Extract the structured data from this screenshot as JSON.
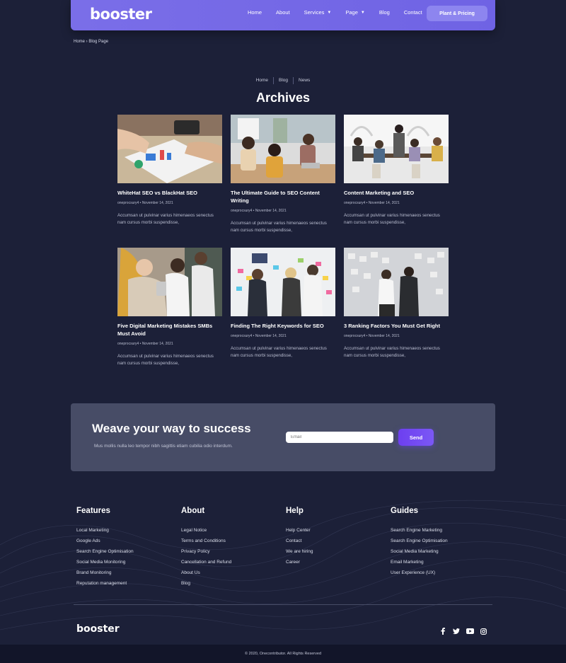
{
  "header": {
    "logo": "booster",
    "nav": [
      {
        "label": "Home"
      },
      {
        "label": "About"
      },
      {
        "label": "Services",
        "dropdown": true
      },
      {
        "label": "Page",
        "dropdown": true
      },
      {
        "label": "Blog"
      },
      {
        "label": "Contact"
      }
    ],
    "cta": "Plant & Pricing"
  },
  "breadcrumb_top": "Home › Blog Page",
  "breadcrumbs": [
    "Home",
    "Blog",
    "News"
  ],
  "page_title": "Archives",
  "posts": [
    {
      "title": "WhiteHat SEO vs BlackHat SEO",
      "meta": "oneprocsury4 • November 14, 2021",
      "excerpt": "Accumsan ut pulvinar varius himenaeos senectus nam cursus morbi suspendisse,"
    },
    {
      "title": "The Ultimate Guide to SEO Content Writing",
      "meta": "oneprocsury4 • November 14, 2021",
      "excerpt": "Accumsan ut pulvinar varius himenaeos senectus nam cursus morbi suspendisse,"
    },
    {
      "title": "Content Marketing and SEO",
      "meta": "oneprocsury4 • November 14, 2021",
      "excerpt": "Accumsan ut pulvinar varius himenaeos senectus nam cursus morbi suspendisse,"
    },
    {
      "title": "Five Digital Marketing Mistakes SMBs Must Avoid",
      "meta": "oneprocsury4 • November 14, 2021",
      "excerpt": "Accumsan ut pulvinar varius himenaeos senectus nam cursus morbi suspendisse,"
    },
    {
      "title": "Finding The Right Keywords for SEO",
      "meta": "oneprocsury4 • November 14, 2021",
      "excerpt": "Accumsan ut pulvinar varius himenaeos senectus nam cursus morbi suspendisse,"
    },
    {
      "title": "3 Ranking Factors You Must Get Right",
      "meta": "oneprocsury4 • November 14, 2021",
      "excerpt": "Accumsan ut pulvinar varius himenaeos senectus nam cursus morbi suspendisse,"
    }
  ],
  "newsletter": {
    "heading": "Weave your way to success",
    "subtext": "Mus mollis nulla leo tempor nibh sagittis etiam cubilia odio interdum.",
    "email_placeholder": "Email",
    "send_label": "Send"
  },
  "footer": {
    "columns": [
      {
        "heading": "Features",
        "links": [
          "Local Marketing",
          "Google Ads",
          "Search Engine Optimisation",
          "Social Media Monitoring",
          "Brand Monitoring",
          "Reputation management"
        ]
      },
      {
        "heading": "About",
        "links": [
          "Legal Notice",
          "Terms and Conditions",
          "Privacy Policy",
          "Cancellation and Refund",
          "About Us",
          "Blog"
        ]
      },
      {
        "heading": "Help",
        "links": [
          "Help Center",
          "Contact",
          "We are hiring",
          "Career"
        ]
      },
      {
        "heading": "Guides",
        "links": [
          "Search Engine Marketing",
          "Search Engine Optimisation",
          "Social Media Marketing",
          "Email Marketing",
          "User Experience (UX)"
        ]
      }
    ],
    "logo": "booster",
    "social": [
      "facebook-icon",
      "twitter-icon",
      "youtube-icon",
      "instagram-icon"
    ],
    "copyright": "© 2020, Onecontributor. All Rights Reserved"
  },
  "colors": {
    "accent": "#7a6ee8",
    "background": "#1c2038",
    "newsletter_bg": "#474c66",
    "send": "#6d3ff0"
  }
}
